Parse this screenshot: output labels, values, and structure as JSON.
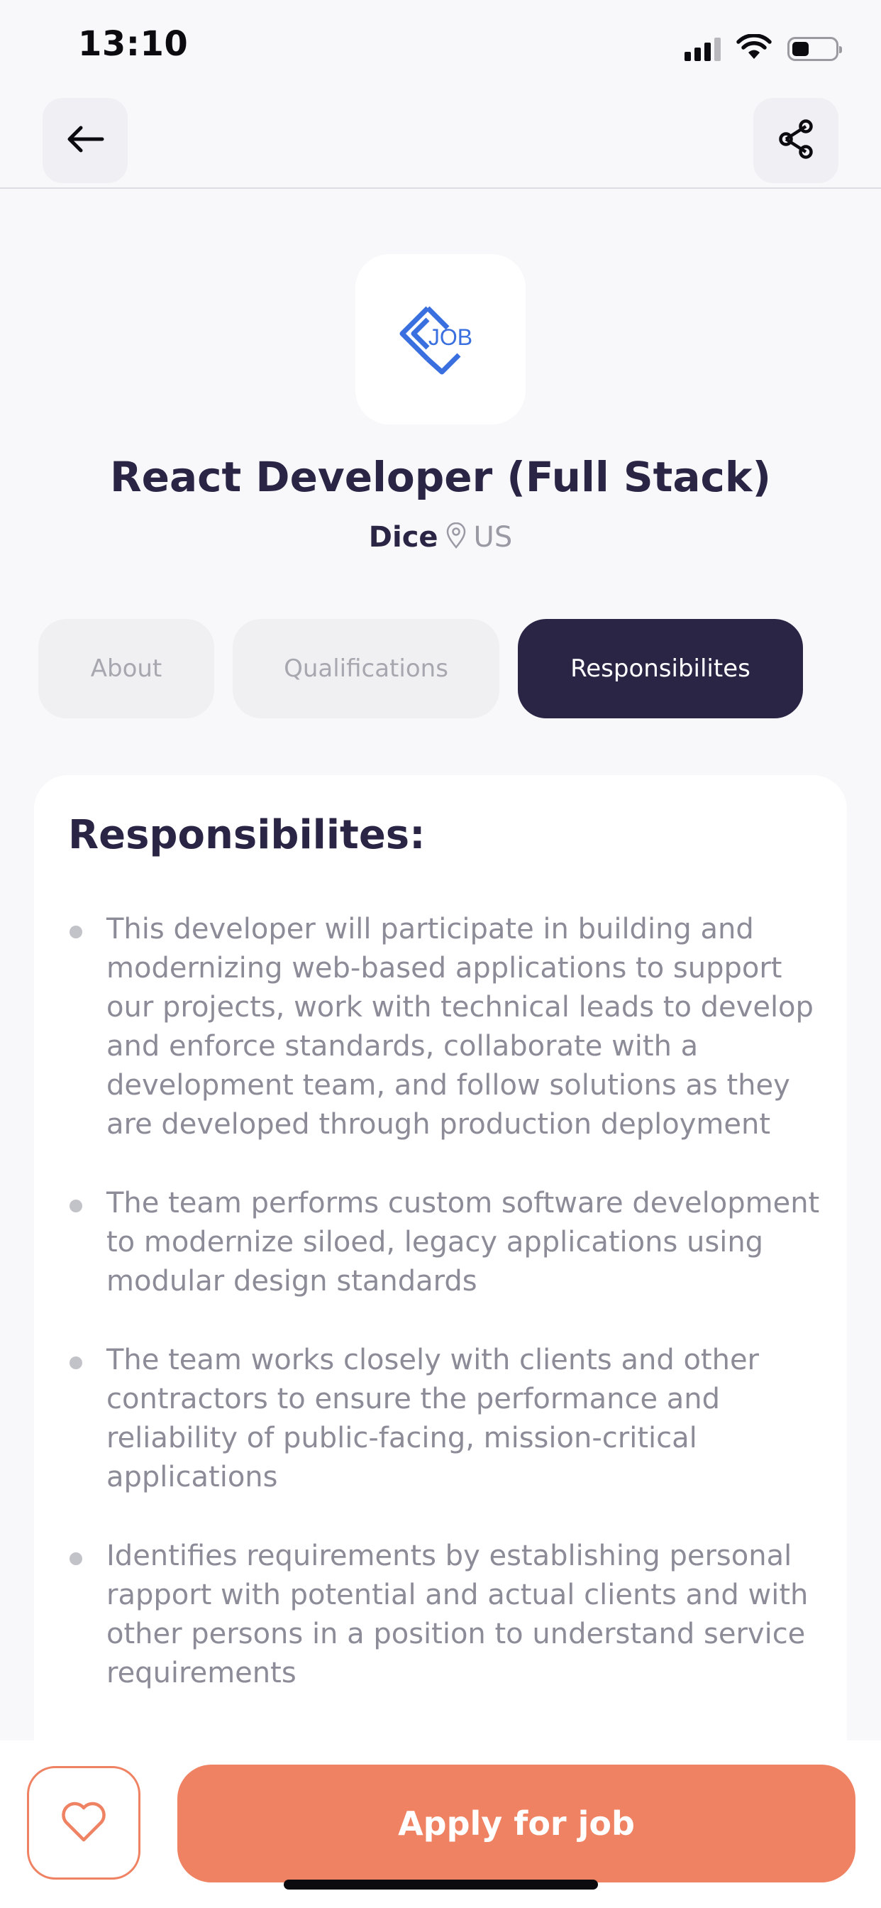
{
  "status_bar": {
    "time": "13:10",
    "icons": [
      "signal-icon",
      "wifi-icon",
      "battery-icon"
    ],
    "signal_bars_active": 3,
    "signal_bars_total": 4,
    "battery_level": 0.4
  },
  "nav": {
    "back_icon": "arrow-left-icon",
    "share_icon": "share-icon"
  },
  "job": {
    "logo_text": "JOB",
    "title": "React Developer (Full Stack)",
    "company": "Dice",
    "location_icon": "map-pin-icon",
    "location": "US"
  },
  "tabs": [
    {
      "label": "About",
      "active": false
    },
    {
      "label": "Qualifications",
      "active": false
    },
    {
      "label": "Responsibilites",
      "active": true
    }
  ],
  "content": {
    "heading": "Responsibilites:",
    "items": [
      "This developer will participate in building and modernizing web-based applications to support our projects, work with technical leads to develop and enforce standards, collaborate with a development team, and follow solutions as they are developed through production deployment",
      "The team performs custom software development to modernize siloed, legacy applications using modular design standards",
      "The team works closely with clients and other contractors to ensure the performance and reliability of public-facing, mission-critical applications",
      "Identifies requirements by establishing personal rapport with potential and actual clients and with other persons in a position to understand service requirements"
    ]
  },
  "actions": {
    "favorite_icon": "heart-icon",
    "apply_label": "Apply for job"
  },
  "colors": {
    "primary_dark": "#2b2545",
    "accent": "#ef8262",
    "logo_blue": "#3a6fe0"
  }
}
